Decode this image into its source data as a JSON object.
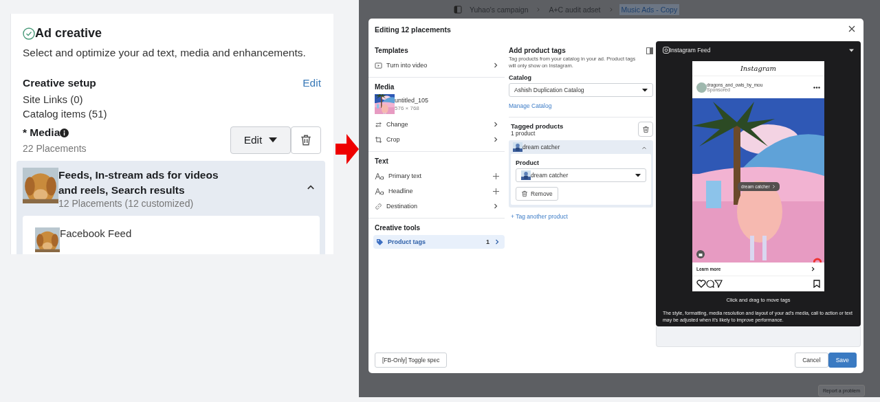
{
  "ad_creative": {
    "title": "Ad creative",
    "description": "Select and optimize your ad text, media and enhancements.",
    "creative_setup": {
      "title": "Creative setup",
      "edit_link": "Edit",
      "items": [
        "Site Links (0)",
        "Catalog items (51)"
      ]
    },
    "media": {
      "label": "* Media",
      "placements": "22 Placements",
      "edit_button": "Edit"
    },
    "group": {
      "title": "Feeds, In-stream ads for videos and reels, Search results",
      "subtitle": "12 Placements (12 customized)",
      "expanded": true,
      "items": [
        {
          "name": "Facebook Feed"
        }
      ]
    }
  },
  "breadcrumbs": [
    {
      "label": "Yuhao's campaign",
      "selected": false
    },
    {
      "label": "A+C audit adset",
      "selected": false
    },
    {
      "label": "Music Ads - Copy",
      "selected": true
    }
  ],
  "modal": {
    "title": "Editing 12 placements",
    "templates": {
      "title": "Templates",
      "items": [
        {
          "label": "Turn into video",
          "kind": "chevron"
        }
      ]
    },
    "media": {
      "title": "Media",
      "file": {
        "name": "untitled_105",
        "size": "576 × 768"
      },
      "items": [
        {
          "label": "Change",
          "kind": "chevron"
        },
        {
          "label": "Crop",
          "kind": "chevron"
        }
      ]
    },
    "text": {
      "title": "Text",
      "items": [
        {
          "label": "Primary text",
          "kind": "plus"
        },
        {
          "label": "Headline",
          "kind": "plus"
        },
        {
          "label": "Destination",
          "kind": "chevron"
        }
      ]
    },
    "creative_tools": {
      "title": "Creative tools",
      "items": [
        {
          "label": "Product tags",
          "count": "1",
          "selected": true
        }
      ]
    },
    "product_tags": {
      "title": "Add product tags",
      "description": "Tag products from your catalog in your ad. Product tags will only show on Instagram.",
      "catalog_label": "Catalog",
      "catalog_value": "Ashish Duplication Catalog",
      "manage_link": "Manage Catalog",
      "tagged_title": "Tagged products",
      "tagged_count": "1 product",
      "products": [
        {
          "name": "dream catcher",
          "expanded": true,
          "field_label": "Product",
          "value": "dream catcher",
          "remove": "Remove"
        }
      ],
      "add_link": "+ Tag another product"
    },
    "preview": {
      "placement": "Instagram Feed",
      "logo": "Instagram",
      "account": "dragons_and_owls_by_mou",
      "sponsored": "Sponsored",
      "tag": "dream catcher",
      "cta": "Learn more",
      "hint": "Click and drag to move tags",
      "disclaimer": "The style, formatting, media resolution and layout of your ad's media, call to action or text may be adjusted when it's likely to improve performance."
    },
    "footer": {
      "toggle_button": "[FB-Only] Toggle spec",
      "cancel": "Cancel",
      "save": "Save"
    }
  },
  "bottom_bar": {
    "report_button": "Report a problem"
  }
}
